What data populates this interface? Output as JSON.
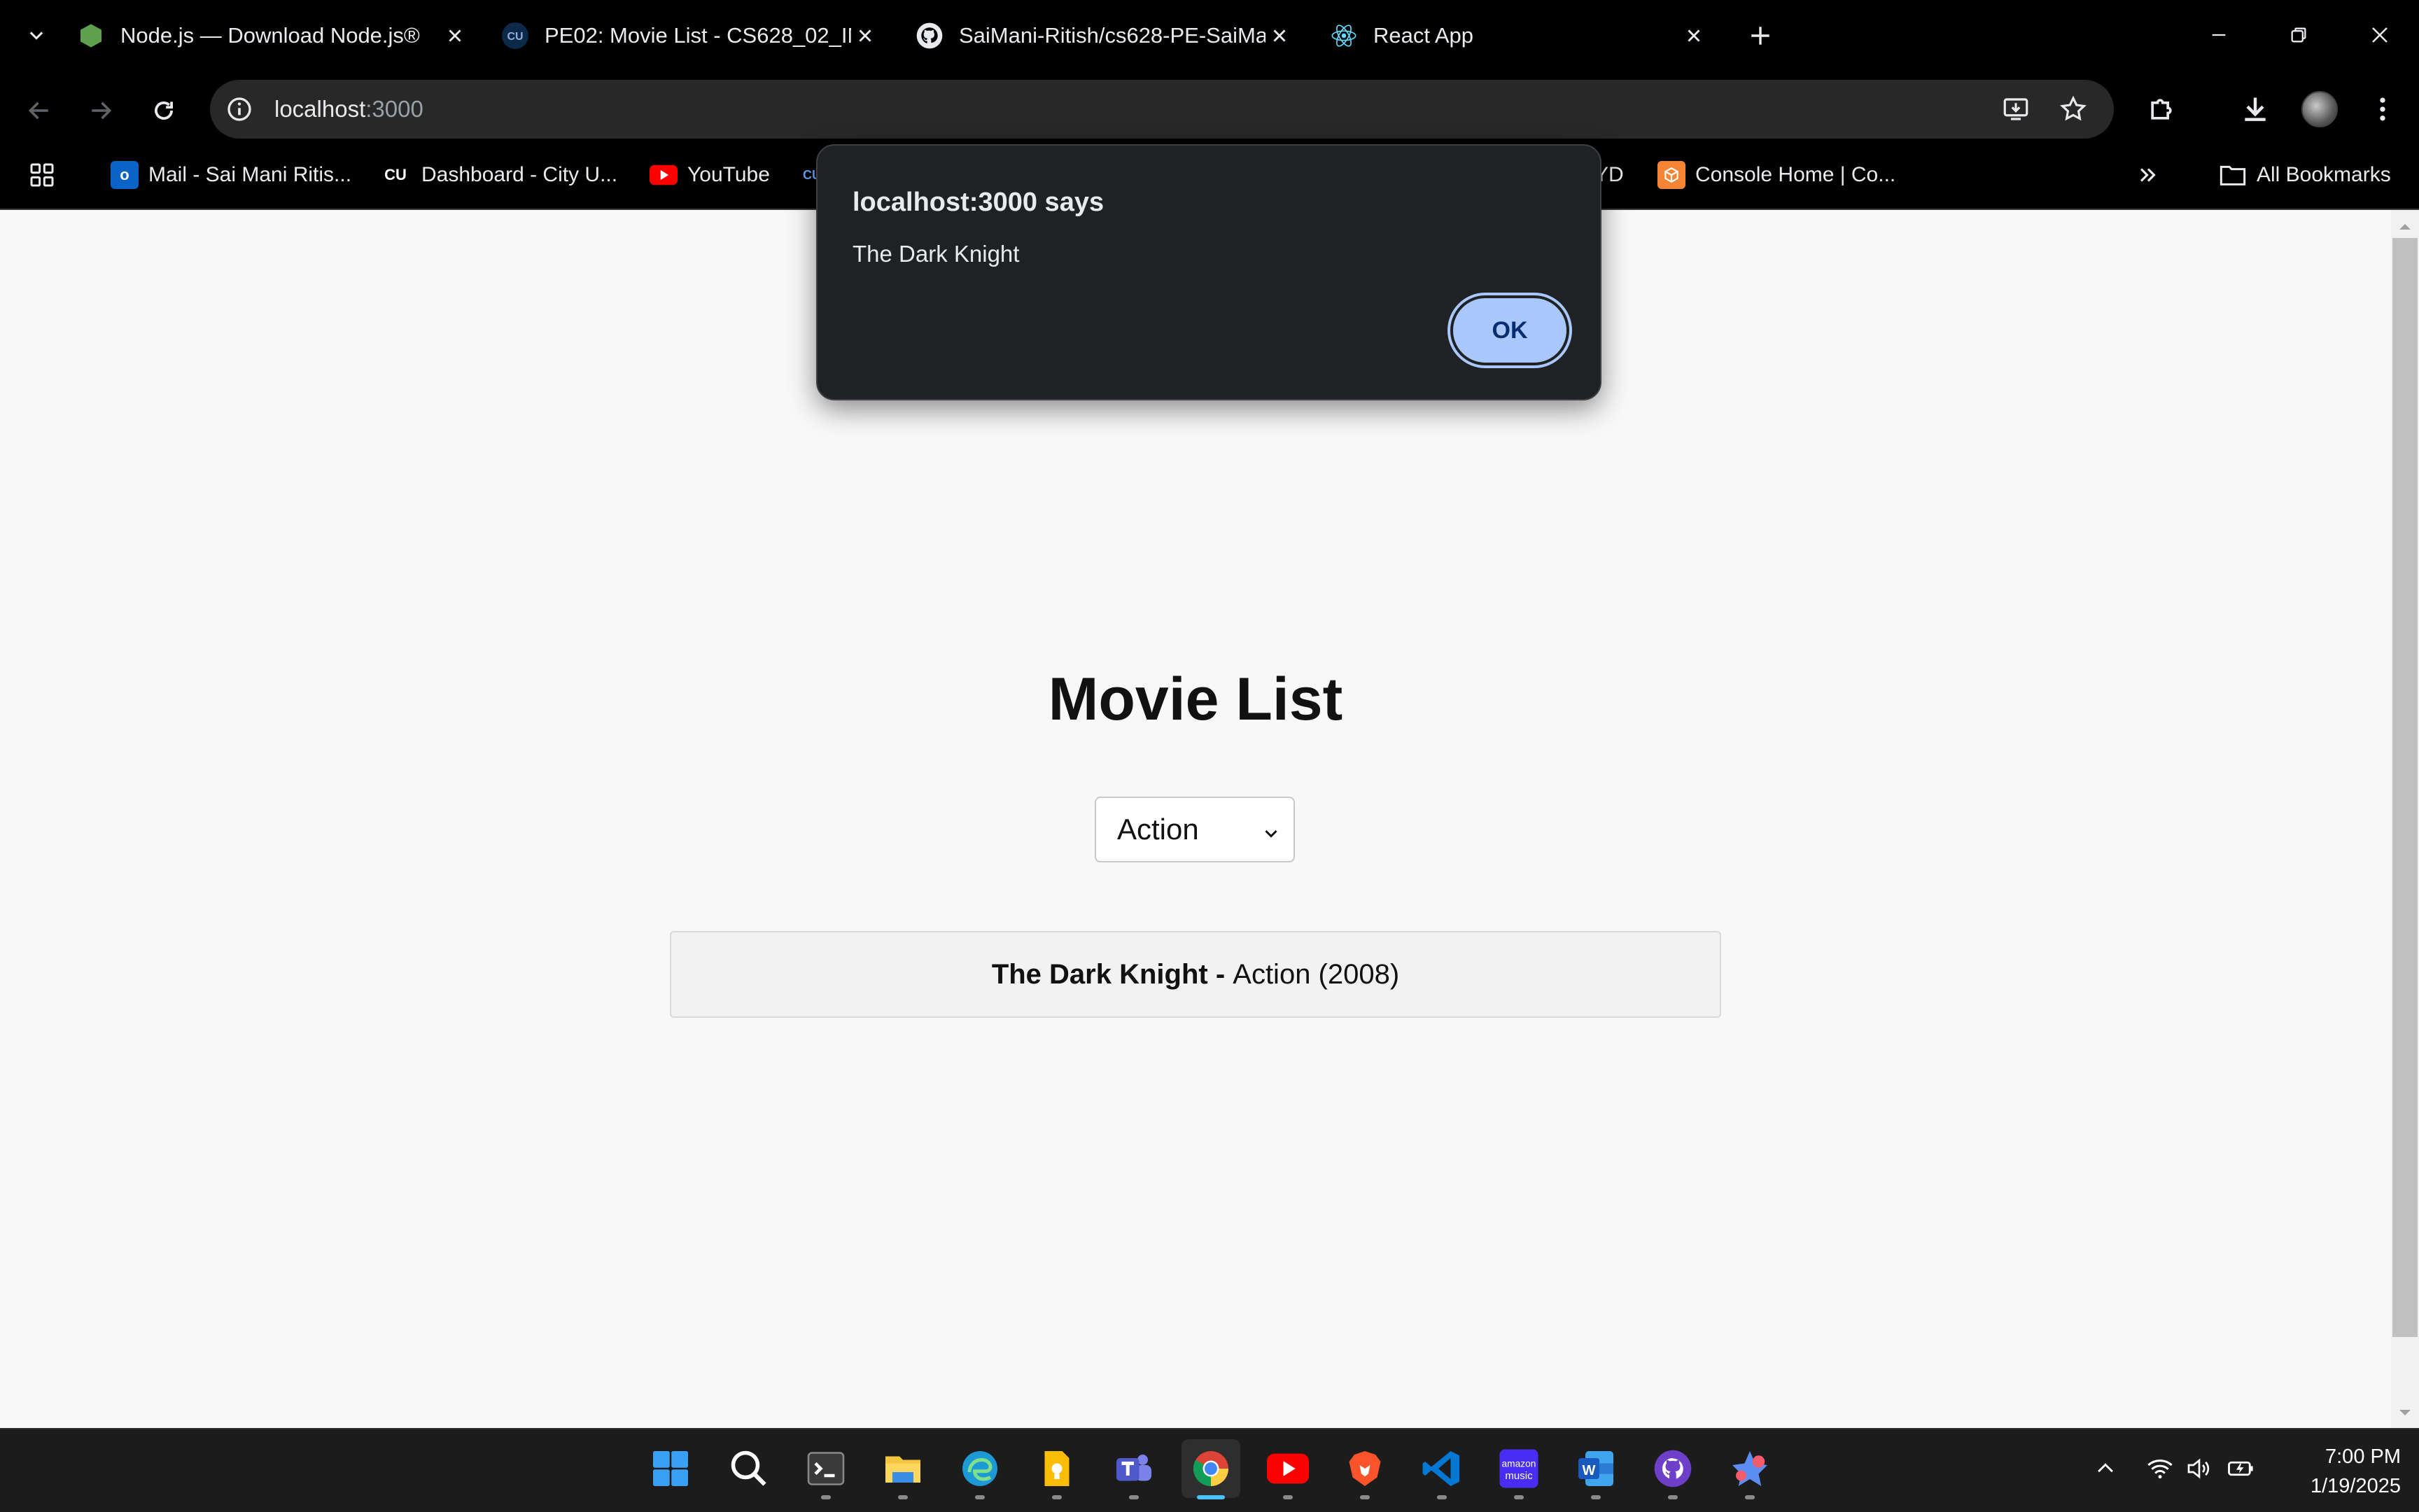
{
  "browser": {
    "tabs": [
      {
        "title": "Node.js — Download Node.js®",
        "icon": "nodejs-icon",
        "active": false
      },
      {
        "title": "PE02: Movie List - CS628_02_IN",
        "icon": "cu-icon",
        "active": false
      },
      {
        "title": "SaiMani-Ritish/cs628-PE-SaiMa",
        "icon": "github-icon",
        "active": false
      },
      {
        "title": "React App",
        "icon": "react-icon",
        "active": true
      }
    ],
    "address": {
      "host": "localhost",
      "port": ":3000"
    },
    "bookmarks": [
      {
        "label": "Mail - Sai Mani Ritis...",
        "icon": "outlook-icon"
      },
      {
        "label": "Dashboard - City U...",
        "icon": "cu-icon"
      },
      {
        "label": "YouTube",
        "icon": "youtube-icon"
      },
      {
        "label": "CU",
        "icon": "cu-icon"
      },
      {
        "label": "YD",
        "icon": "bookmark-icon"
      },
      {
        "label": "Console Home | Co...",
        "icon": "aws-icon"
      }
    ],
    "all_bookmarks": "All Bookmarks"
  },
  "page": {
    "title": "Movie List",
    "genre_select": {
      "selected": "Action"
    },
    "movies": [
      {
        "title": "The Dark Knight",
        "separator": " - ",
        "details": "Action (2008)"
      }
    ]
  },
  "dialog": {
    "title": "localhost:3000 says",
    "message": "The Dark Knight",
    "ok_label": "OK"
  },
  "taskbar": {
    "apps": [
      "start-icon",
      "search-icon",
      "terminal-icon",
      "file-explorer-icon",
      "edge-icon",
      "keep-icon",
      "teams-icon",
      "chrome-icon",
      "youtube-icon",
      "brave-icon",
      "vscode-icon",
      "amazon-music-icon",
      "word-icon",
      "github-desktop-icon",
      "other-app-icon"
    ],
    "time": "7:00 PM",
    "date": "1/19/2025"
  },
  "colors": {
    "dialog_bg": "#202124",
    "ok_button": "#a8c7fa",
    "page_bg": "#f8f8f8",
    "taskbar_active": "#4cc2ff"
  }
}
